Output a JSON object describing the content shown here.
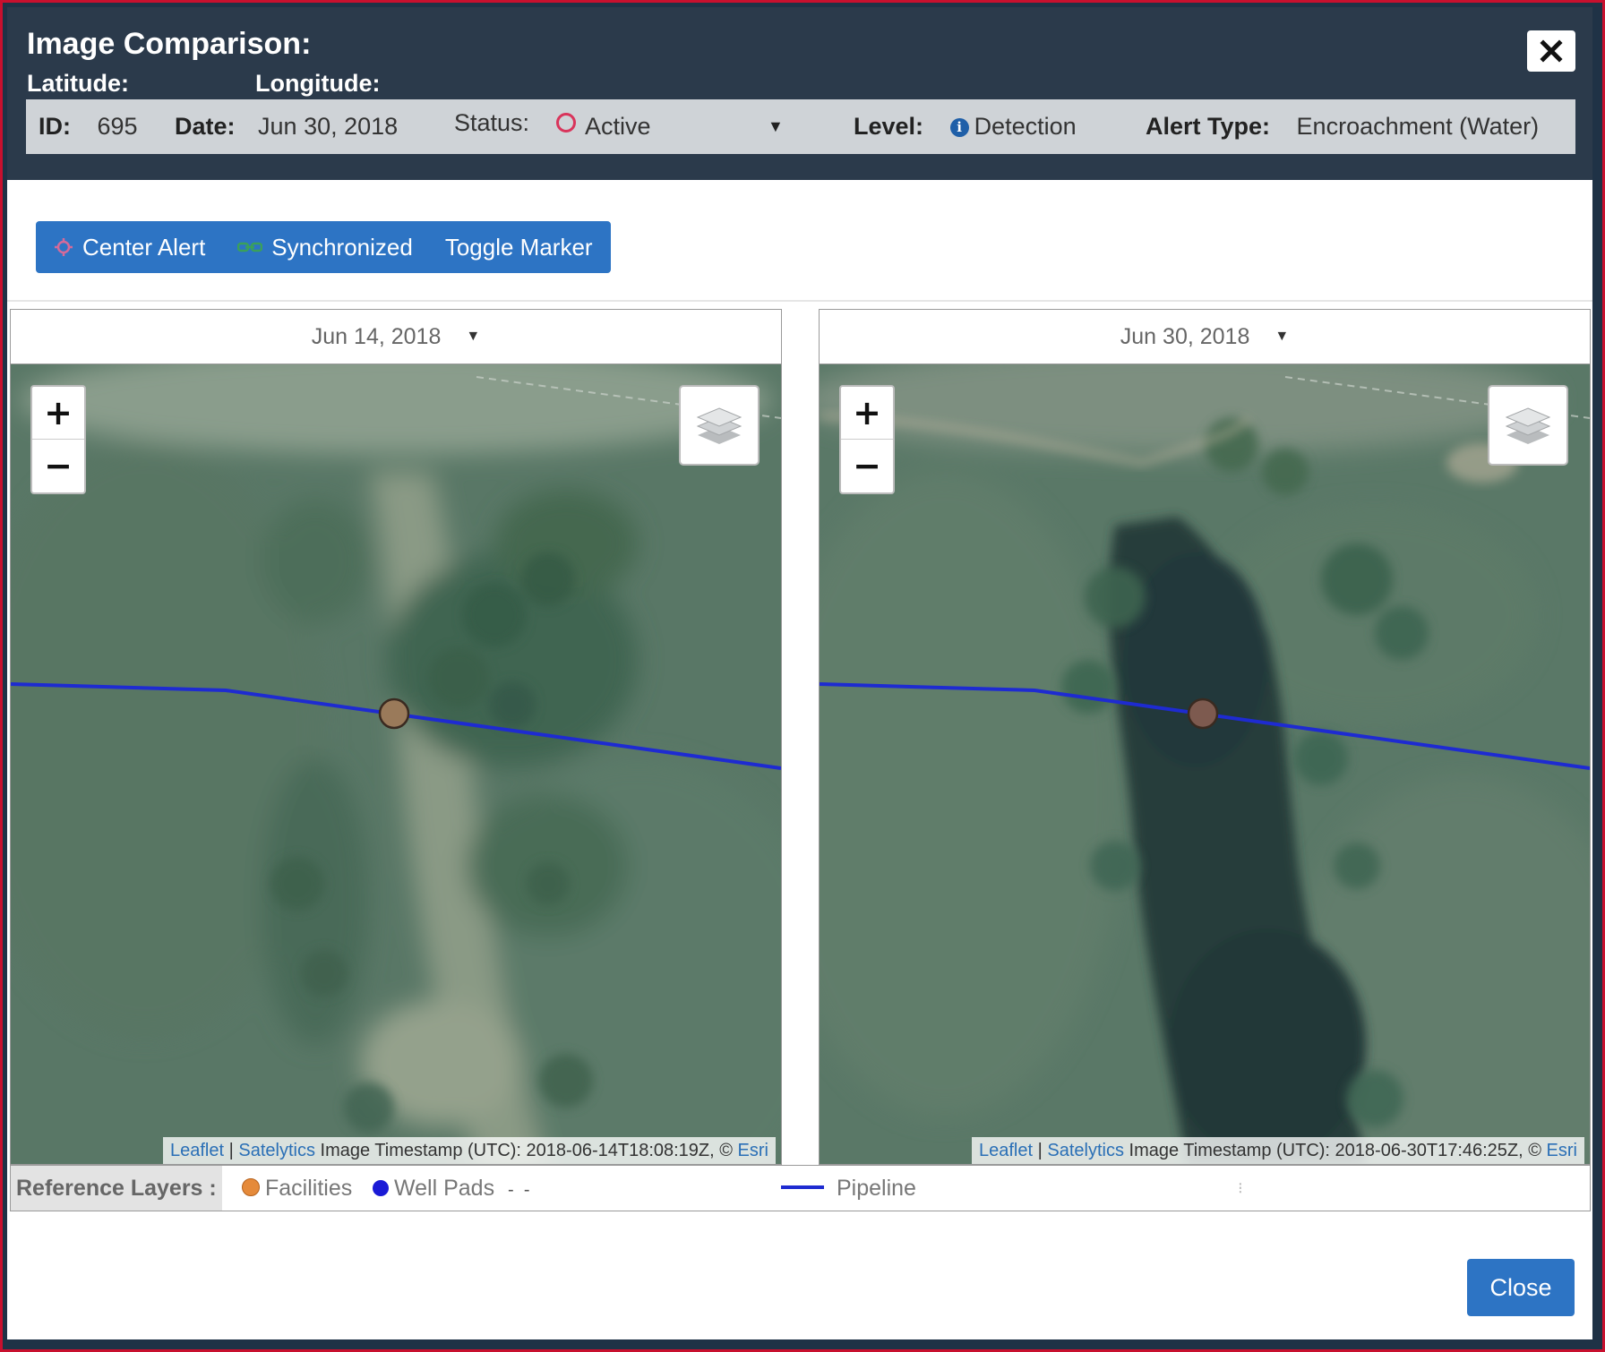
{
  "dialog": {
    "title": "Image Comparison:",
    "latitude_label": "Latitude:",
    "longitude_label": "Longitude:",
    "close_icon": "close-icon"
  },
  "alert": {
    "id_label": "ID:",
    "id": "695",
    "date_label": "Date:",
    "date": "Jun 30, 2018",
    "status_label": "Status:",
    "status": "Active",
    "level_label": "Level:",
    "level": "Detection",
    "alert_type_label": "Alert Type:",
    "alert_type": "Encroachment (Water)"
  },
  "toolbar": {
    "center_alert": "Center Alert",
    "synchronized": "Synchronized",
    "toggle_marker": "Toggle Marker"
  },
  "maps": {
    "left": {
      "date": "Jun 14, 2018",
      "attribution_leaflet": "Leaflet",
      "attribution_satelytics": "Satelytics",
      "attribution_timestamp": " Image Timestamp (UTC): 2018-06-14T18:08:19Z, © ",
      "attribution_esri": "Esri"
    },
    "right": {
      "date": "Jun 30, 2018",
      "attribution_leaflet": "Leaflet",
      "attribution_satelytics": "Satelytics",
      "attribution_timestamp": " Image Timestamp (UTC): 2018-06-30T17:46:25Z, © ",
      "attribution_esri": "Esri"
    },
    "zoom_in": "+",
    "zoom_out": "−",
    "separator": " | "
  },
  "reference_layers": {
    "label": "Reference Layers :",
    "facilities": "Facilities",
    "well_pads": "Well Pads",
    "pipeline": "Pipeline"
  },
  "footer": {
    "close": "Close"
  },
  "colors": {
    "header_bg": "#2b3a4b",
    "accent_blue": "#2d74c4",
    "pipeline": "#1e2bd1",
    "facility_orange": "#e58a3a",
    "well_pad_blue": "#1a1ad6",
    "status_active": "#d9345b"
  }
}
